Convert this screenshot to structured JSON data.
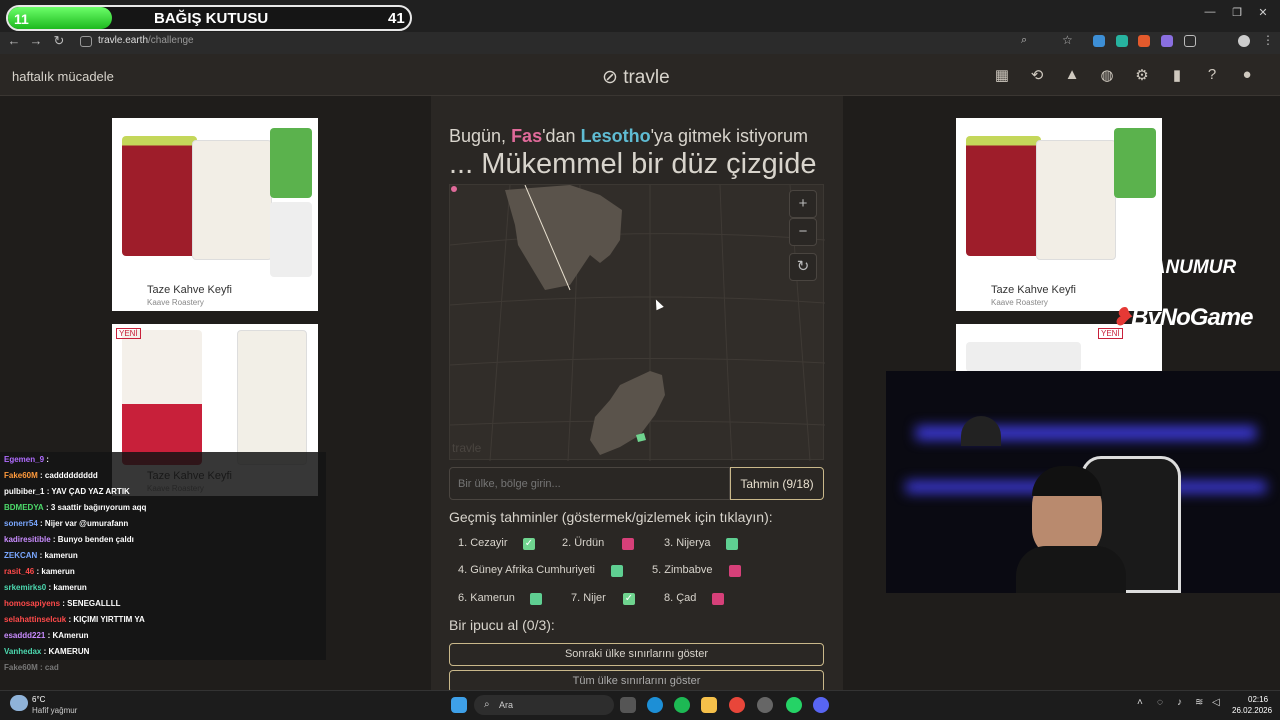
{
  "donation": {
    "count": "11",
    "title": "BAĞIŞ KUTUSU",
    "target": "41"
  },
  "browser": {
    "url_host": "travle.earth",
    "url_path": "/challenge"
  },
  "header": {
    "weekly": "haftalık mücadele",
    "logo": "travle"
  },
  "ads": {
    "caption": "Taze Kahve Keyfi",
    "sponsor": "Kaave Roastery",
    "badge": "YENİ"
  },
  "game": {
    "q_prefix": "Bugün, ",
    "from": "Fas",
    "q_mid": "'dan ",
    "to": "Lesotho",
    "q_suffix": "'ya gitmek istiyorum",
    "q2": "... Mükemmel bir düz çizgide",
    "zoom_in": "+",
    "zoom_out": "−",
    "reset": "↻",
    "watermark": "travle",
    "input_placeholder": "Bir ülke, bölge girin...",
    "guess_button": "Tahmin (9/18)",
    "history_title": "Geçmiş tahminler (göstermek/gizlemek için tıklayın):",
    "guesses": [
      {
        "label": "1.  Cezayir",
        "status": "ok"
      },
      {
        "label": "2.  Ürdün",
        "status": "bad"
      },
      {
        "label": "3.  Nijerya",
        "status": "near"
      },
      {
        "label": "4.  Güney Afrika Cumhuriyeti",
        "status": "near"
      },
      {
        "label": "5.  Zimbabve",
        "status": "bad"
      },
      {
        "label": "6.  Kamerun",
        "status": "near"
      },
      {
        "label": "7.  Nijer",
        "status": "ok"
      },
      {
        "label": "8.  Çad",
        "status": "bad"
      }
    ],
    "hint_title": "Bir ipucu al (0/3):",
    "hint_next": "Sonraki ülke sınırlarını göster",
    "hint_all": "Tüm ülke sınırlarını göster"
  },
  "overlay": {
    "brand1": "AFANUMUR",
    "brand2": "ByNoGame"
  },
  "chat": [
    {
      "user": "Egemen_9",
      "msg": ":",
      "color": "#b06cff"
    },
    {
      "user": "Fake60M",
      "msg": ": caddddddddd",
      "color": "#ff9a3c"
    },
    {
      "user": "pulbiber_1",
      "msg": ": YAV ÇAD YAZ ARTIK",
      "color": "#ffffff"
    },
    {
      "user": "BDMEDYA",
      "msg": ": 3 saattir bağırıyorum aqq",
      "color": "#4cd96a"
    },
    {
      "user": "sonerr54",
      "msg": ": Nijer var @umurafann",
      "color": "#7aa7ff"
    },
    {
      "user": "kadiresitible",
      "msg": ": Bunyo benden çaldı",
      "color": "#c98cff"
    },
    {
      "user": "ZEKCAN",
      "msg": ": kamerun",
      "color": "#7aa7ff"
    },
    {
      "user": "rasit_46",
      "msg": ": kamerun",
      "color": "#ff4a4a"
    },
    {
      "user": "srkemirks0",
      "msg": ": kamerun",
      "color": "#4cd9b0"
    },
    {
      "user": "homosapiyens",
      "msg": ": SENEGALLLL",
      "color": "#ff4a4a"
    },
    {
      "user": "selahattinselcuk",
      "msg": ": KIÇIMI YIRTTIM YA",
      "color": "#ff4a4a"
    },
    {
      "user": "esaddd221",
      "msg": ": KAmerun",
      "color": "#c98cff"
    },
    {
      "user": "Vanhedax",
      "msg": ": KAMERUN",
      "color": "#4cd9b0"
    },
    {
      "user": "Fake60M",
      "msg": ": cad",
      "color": "#777777"
    }
  ],
  "taskbar": {
    "temp": "6°C",
    "weather": "Hafif yağmur",
    "search": "Ara",
    "time": "02:16",
    "date": "26.02.2026"
  },
  "colors": {
    "from": "#e06a9a",
    "to": "#5fbcd3",
    "ok": "#6fd48f",
    "bad": "#d64079",
    "accent_border": "#c9b88a"
  }
}
